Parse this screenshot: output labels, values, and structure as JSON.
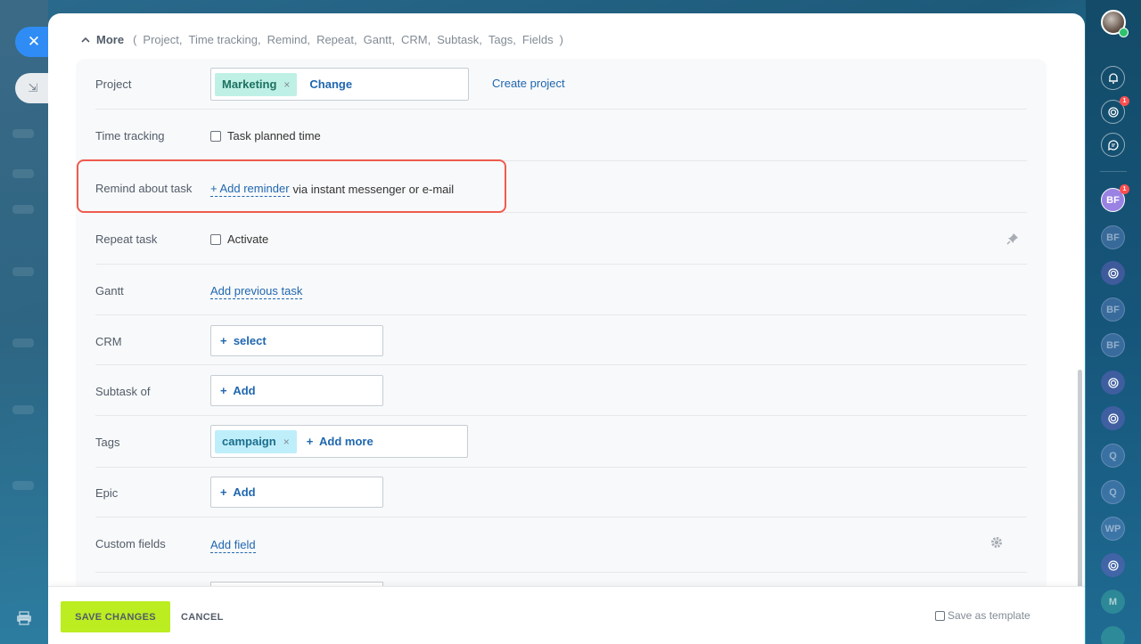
{
  "window": {
    "close_glyph": "✕",
    "minimize_glyph": "⇲"
  },
  "more": {
    "label": "More",
    "items_open": "(",
    "items": [
      "Project,",
      "Time tracking,",
      "Remind,",
      "Repeat,",
      "Gantt,",
      "CRM,",
      "Subtask,",
      "Tags,",
      "Fields"
    ],
    "items_close": ")"
  },
  "fields": {
    "project": {
      "label": "Project",
      "tag": "Marketing",
      "remove": "×",
      "change": "Change",
      "create": "Create project"
    },
    "time_tracking": {
      "label": "Time tracking",
      "checkbox_label": "Task planned time"
    },
    "remind": {
      "label": "Remind about task",
      "link": "+ Add reminder",
      "suffix": "via instant messenger or e-mail"
    },
    "repeat": {
      "label": "Repeat task",
      "checkbox_label": "Activate"
    },
    "gantt": {
      "label": "Gantt",
      "link": "Add previous task"
    },
    "crm": {
      "label": "CRM",
      "button": "+  select"
    },
    "subtask": {
      "label": "Subtask of",
      "button": "+  Add"
    },
    "tags": {
      "label": "Tags",
      "tag": "campaign",
      "remove": "×",
      "add_more": "+  Add more"
    },
    "epic": {
      "label": "Epic",
      "button": "+  Add"
    },
    "custom": {
      "label": "Custom fields",
      "link": "Add field"
    }
  },
  "footer": {
    "save": "SAVE CHANGES",
    "cancel": "CANCEL",
    "save_template": "Save as template"
  },
  "rail": {
    "badge_count": "1",
    "avatars": [
      "BF",
      "BF",
      "BF",
      "BF",
      "Q",
      "Q",
      "WP",
      "M"
    ]
  },
  "colors": {
    "accent_blue": "#2067b0",
    "save_green": "#bbed21",
    "highlight_red": "#ef5b4e",
    "tag_green": "#bff0e6",
    "tag_blue": "#bfeefb"
  }
}
